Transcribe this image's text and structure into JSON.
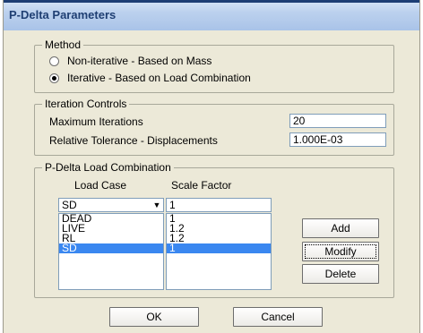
{
  "window": {
    "title": "P-Delta Parameters"
  },
  "method": {
    "legend": "Method",
    "options": [
      {
        "label": "Non-iterative - Based on Mass",
        "checked": false
      },
      {
        "label": "Iterative - Based on Load Combination",
        "checked": true
      }
    ]
  },
  "iteration": {
    "legend": "Iteration Controls",
    "max_iter_label": "Maximum Iterations",
    "max_iter_value": "20",
    "tolerance_label": "Relative Tolerance - Displacements",
    "tolerance_value": "1.000E-03"
  },
  "combo": {
    "legend": "P-Delta Load Combination",
    "load_case_header": "Load Case",
    "scale_factor_header": "Scale Factor",
    "selected_case": "SD",
    "scale_input": "1",
    "rows": [
      {
        "case": "DEAD",
        "factor": "1",
        "selected": false
      },
      {
        "case": "LIVE",
        "factor": "1.2",
        "selected": false
      },
      {
        "case": "RL",
        "factor": "1.2",
        "selected": false
      },
      {
        "case": "SD",
        "factor": "1",
        "selected": true
      }
    ],
    "add_label": "Add",
    "modify_label": "Modify",
    "delete_label": "Delete"
  },
  "footer": {
    "ok_label": "OK",
    "cancel_label": "Cancel"
  },
  "colors": {
    "selection": "#3a87f0",
    "title_text": "#1f3f73"
  }
}
